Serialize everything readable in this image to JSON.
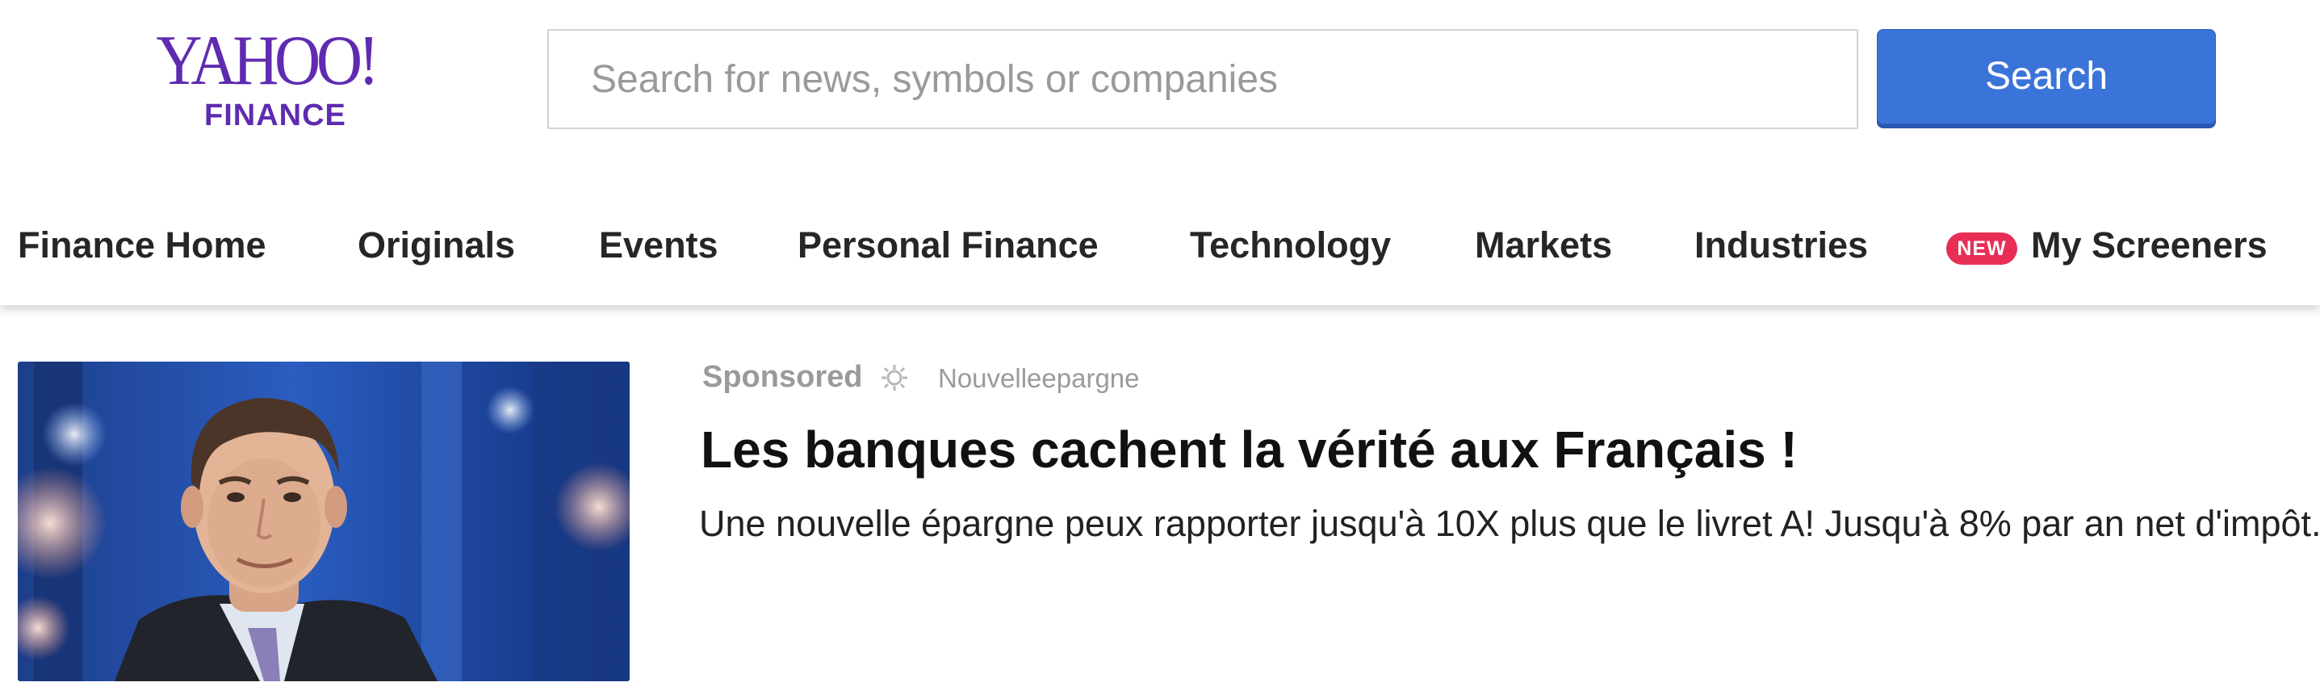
{
  "logo": {
    "brand": "YAHOO!",
    "subtitle": "FINANCE"
  },
  "search": {
    "placeholder": "Search for news, symbols or companies",
    "button_label": "Search"
  },
  "nav": {
    "items": [
      {
        "label": "Finance Home"
      },
      {
        "label": "Originals"
      },
      {
        "label": "Events"
      },
      {
        "label": "Personal Finance"
      },
      {
        "label": "Technology"
      },
      {
        "label": "Markets"
      },
      {
        "label": "Industries"
      },
      {
        "label": "My Screeners",
        "badge": "NEW"
      }
    ]
  },
  "ad": {
    "sponsored_label": "Sponsored",
    "adchoice_icon": "adchoices-icon",
    "advertiser": "Nouvelleepargne",
    "title": "Les banques cachent la vérité aux Français !",
    "description": "Une nouvelle épargne peux rapporter jusqu'à 10X plus que le livret A! Jusqu'à 8% par an net d'impôt.",
    "thumbnail_subject": "news-anchor-portrait"
  },
  "colors": {
    "brand_purple": "#5f2bb0",
    "search_button": "#3b74d9",
    "badge_red": "#e82e55"
  }
}
